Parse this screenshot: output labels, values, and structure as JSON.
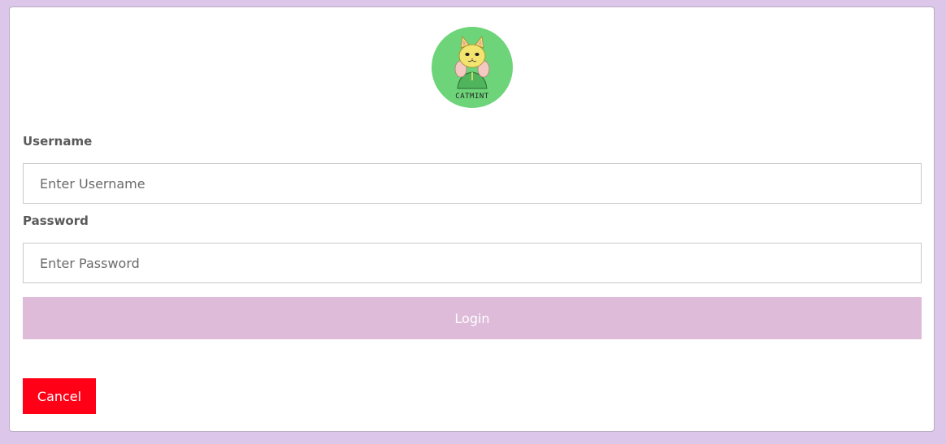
{
  "logo": {
    "icon": "catmint-cat-logo-icon",
    "text": "CATMINT",
    "background_color": "#6dd479"
  },
  "form": {
    "username_label": "Username",
    "username_placeholder": "Enter Username",
    "username_value": "",
    "password_label": "Password",
    "password_placeholder": "Enter Password",
    "password_value": "",
    "login_label": "Login",
    "cancel_label": "Cancel"
  },
  "colors": {
    "page_background": "#dcc6ea",
    "login_button": "#ddbbd9",
    "cancel_button": "#ff0017"
  }
}
